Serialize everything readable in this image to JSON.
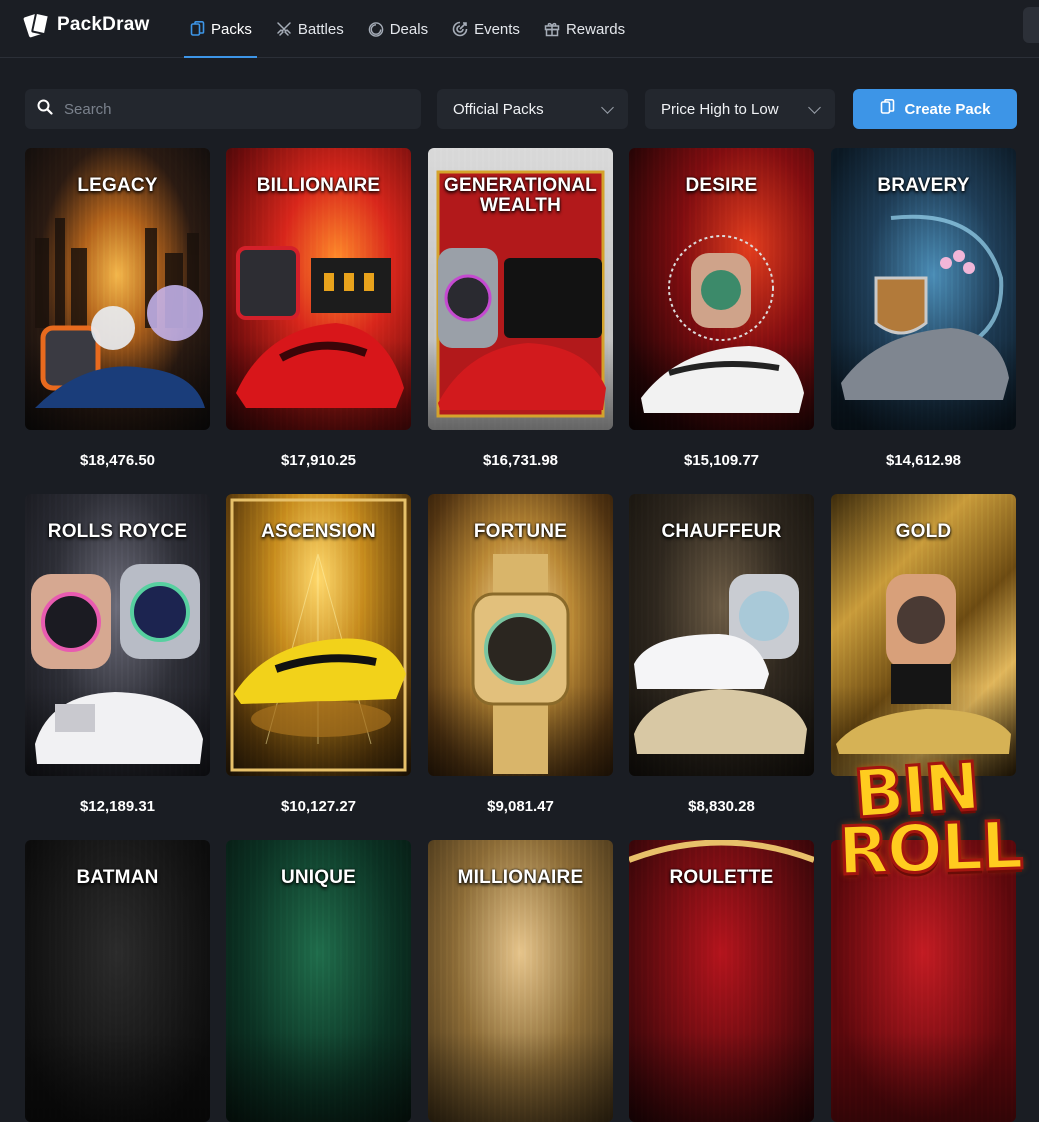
{
  "app": {
    "name": "PackDraw"
  },
  "nav": [
    {
      "label": "Packs",
      "icon": "pack-icon",
      "active": true
    },
    {
      "label": "Battles",
      "icon": "swords-icon",
      "active": false
    },
    {
      "label": "Deals",
      "icon": "deals-icon",
      "active": false
    },
    {
      "label": "Events",
      "icon": "events-icon",
      "active": false
    },
    {
      "label": "Rewards",
      "icon": "gift-icon",
      "active": false
    }
  ],
  "controls": {
    "search_placeholder": "Search",
    "filter_selected": "Official Packs",
    "sort_selected": "Price High to Low",
    "create_label": "Create Pack"
  },
  "packs": [
    {
      "name": "LEGACY",
      "price": "$18,476.50"
    },
    {
      "name": "BILLIONAIRE",
      "price": "$17,910.25"
    },
    {
      "name": "GENERATIONAL WEALTH",
      "price": "$16,731.98"
    },
    {
      "name": "DESIRE",
      "price": "$15,109.77"
    },
    {
      "name": "BRAVERY",
      "price": "$14,612.98"
    },
    {
      "name": "ROLLS ROYCE",
      "price": "$12,189.31"
    },
    {
      "name": "ASCENSION",
      "price": "$10,127.27"
    },
    {
      "name": "FORTUNE",
      "price": "$9,081.47"
    },
    {
      "name": "CHAUFFEUR",
      "price": "$8,830.28"
    },
    {
      "name": "GOLD",
      "price": ""
    },
    {
      "name": "BATMAN",
      "price": ""
    },
    {
      "name": "UNIQUE",
      "price": ""
    },
    {
      "name": "MILLIONAIRE",
      "price": ""
    },
    {
      "name": "ROULETTE",
      "price": ""
    },
    {
      "name": "",
      "price": ""
    }
  ],
  "promo": {
    "line1": "BIN",
    "line2": "ROLL"
  },
  "colors": {
    "accent": "#3d95e7",
    "background": "#1a1d23",
    "surface": "#23272e"
  }
}
